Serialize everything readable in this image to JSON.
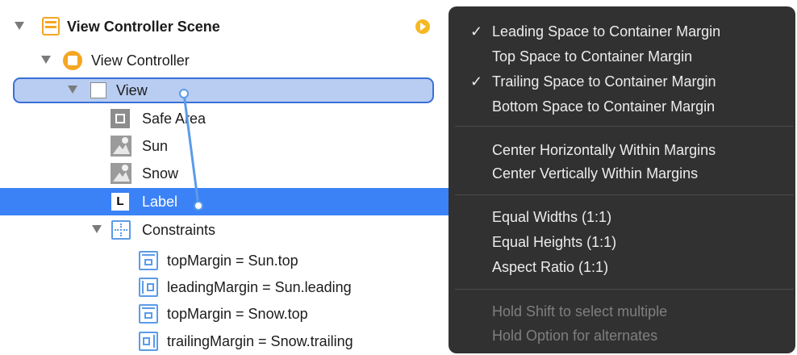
{
  "outline": {
    "scene_title": "View Controller Scene",
    "view_controller": "View Controller",
    "view": "View",
    "safe_area": "Safe Area",
    "sun": "Sun",
    "snow": "Snow",
    "label": "Label",
    "label_icon_letter": "L",
    "constraints": "Constraints",
    "constraint_items": [
      "topMargin = Sun.top",
      "leadingMargin = Sun.leading",
      "topMargin = Snow.top",
      "trailingMargin = Snow.trailing"
    ]
  },
  "menu": {
    "checkmark": "✓",
    "group1": [
      {
        "label": "Leading Space to Container Margin",
        "checked": true
      },
      {
        "label": "Top Space to Container Margin",
        "checked": false
      },
      {
        "label": "Trailing Space to Container Margin",
        "checked": true
      },
      {
        "label": "Bottom Space to Container Margin",
        "checked": false
      }
    ],
    "group2": [
      {
        "label": "Center Horizontally Within Margins"
      },
      {
        "label": "Center Vertically Within Margins"
      }
    ],
    "group3": [
      {
        "label": "Equal Widths (1:1)"
      },
      {
        "label": "Equal Heights (1:1)"
      },
      {
        "label": "Aspect Ratio (1:1)"
      }
    ],
    "hints": [
      {
        "label": "Hold Shift to select multiple"
      },
      {
        "label": "Hold Option for alternates"
      }
    ]
  },
  "colors": {
    "selection": "#3b82f6",
    "menu_bg": "#313131",
    "connector": "#5b9bea",
    "scene_icon": "#f5a623",
    "warning_badge": "#f6b922"
  }
}
